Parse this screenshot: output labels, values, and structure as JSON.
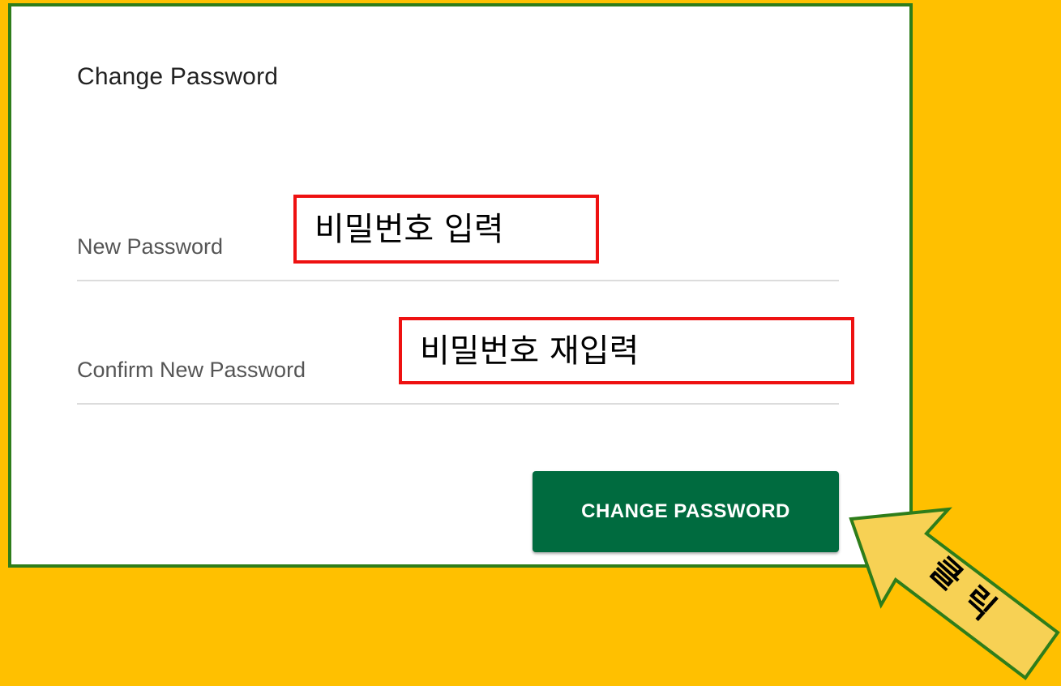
{
  "form": {
    "title": "Change Password",
    "new_password_label": "New Password",
    "confirm_password_label": "Confirm New Password",
    "submit_label": "CHANGE PASSWORD"
  },
  "annotations": {
    "new_password_hint": "비밀번호 입력",
    "confirm_password_hint": "비밀번호 재입력",
    "click_hint": "클릭"
  },
  "colors": {
    "background": "#FFC000",
    "panel_border": "#2E7D1A",
    "button": "#006B3F",
    "annotation_border": "#EE1111",
    "arrow_fill": "#F7D154",
    "arrow_stroke": "#2E7D1A"
  }
}
